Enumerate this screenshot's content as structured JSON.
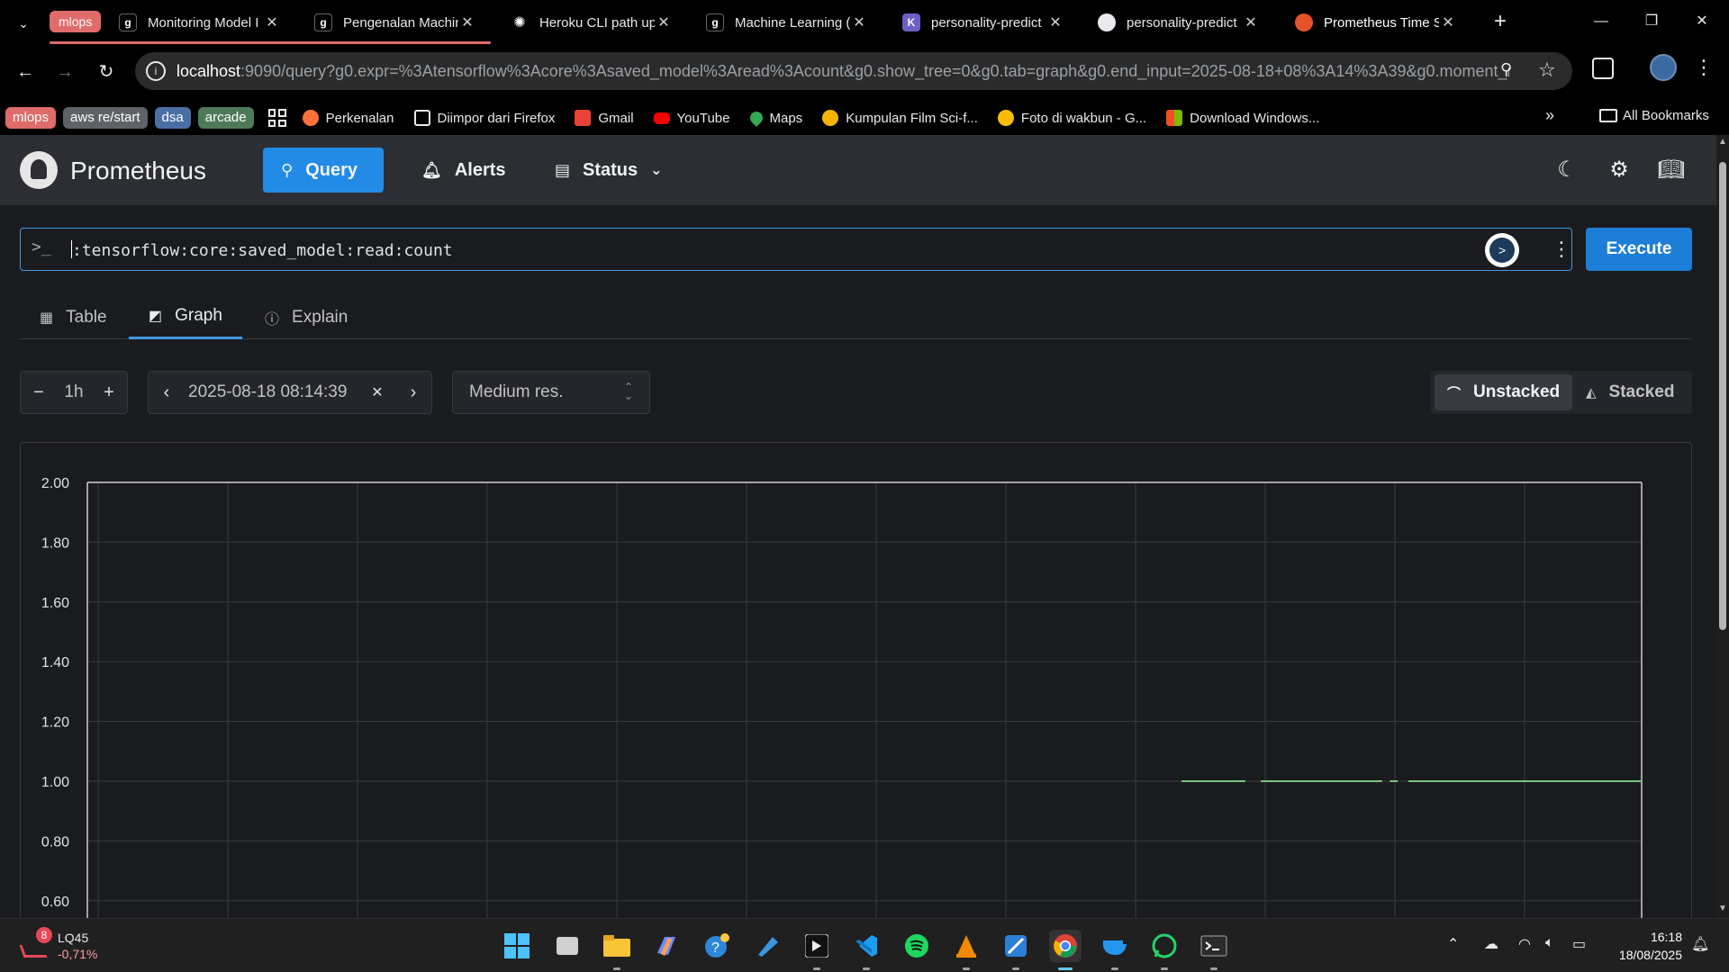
{
  "browser": {
    "tab_group_label": "mlops",
    "tabs": [
      {
        "title": "Monitoring Model I",
        "icon": "gitbook-icon",
        "active": false
      },
      {
        "title": "Pengenalan Machin",
        "icon": "gitbook-icon",
        "active": false
      },
      {
        "title": "Heroku CLI path up",
        "icon": "openai-icon",
        "active": false
      },
      {
        "title": "Machine Learning (",
        "icon": "gitbook-icon",
        "active": false
      },
      {
        "title": "personality-predict",
        "icon": "heroku-icon",
        "active": false
      },
      {
        "title": "personality-predict",
        "icon": "github-icon",
        "active": false
      },
      {
        "title": "Prometheus Time S",
        "icon": "prometheus-icon",
        "active": true
      }
    ],
    "url_host": "localhost",
    "url_rest": ":9090/query?g0.expr=%3Atensorflow%3Acore%3Asaved_model%3Aread%3Acount&g0.show_tree=0&g0.tab=graph&g0.end_input=2025-08-18+08%3A14%3A39&g0.moment_i...",
    "bookmark_chips": [
      {
        "label": "mlops",
        "color": "#e06b6b"
      },
      {
        "label": "aws re/start",
        "color": "#5f6368"
      },
      {
        "label": "dsa",
        "color": "#4a6fa5"
      },
      {
        "label": "arcade",
        "color": "#4f7a5a"
      }
    ],
    "bookmarks": [
      {
        "label": "Perkenalan",
        "icon_color": "#ff7139"
      },
      {
        "label": "Diimpor dari Firefox",
        "icon_color": "folder"
      },
      {
        "label": "Gmail",
        "icon_color": "#ea4335"
      },
      {
        "label": "YouTube",
        "icon_color": "#ff0000"
      },
      {
        "label": "Maps",
        "icon_color": "#34a853"
      },
      {
        "label": "Kumpulan Film Sci-f...",
        "icon_color": "#f4b400"
      },
      {
        "label": "Foto di wakbun - G...",
        "icon_color": "#fbbc04"
      },
      {
        "label": "Download Windows...",
        "icon_color": "#00a4ef"
      }
    ],
    "all_bookmarks_label": "All Bookmarks"
  },
  "app": {
    "brand": "Prometheus",
    "nav": {
      "query": "Query",
      "alerts": "Alerts",
      "status": "Status"
    },
    "expression": ":tensorflow:core:saved_model:read:count",
    "execute_label": "Execute",
    "tabs": {
      "table": "Table",
      "graph": "Graph",
      "explain": "Explain"
    },
    "range": "1h",
    "end_time": "2025-08-18 08:14:39",
    "resolution": "Medium res.",
    "stack": {
      "unstacked": "Unstacked",
      "stacked": "Stacked"
    }
  },
  "chart_data": {
    "type": "line",
    "title": "",
    "xlabel": "",
    "ylabel": "",
    "ylim": [
      0.6,
      2.0
    ],
    "y_ticks": [
      "2.00",
      "1.80",
      "1.60",
      "1.40",
      "1.20",
      "1.00",
      "0.80",
      "0.60"
    ],
    "x_range_fraction": [
      0,
      1
    ],
    "grid": true,
    "series": [
      {
        "color": "#7bc87b",
        "segments": [
          {
            "x": [
              0.704,
              0.745
            ],
            "y": [
              1.0,
              1.0
            ]
          },
          {
            "x": [
              0.755,
              0.833
            ],
            "y": [
              1.0,
              1.0
            ]
          },
          {
            "x": [
              0.838,
              0.843
            ],
            "y": [
              1.0,
              1.0
            ]
          },
          {
            "x": [
              0.85,
              1.0
            ],
            "y": [
              1.0,
              1.0
            ]
          }
        ]
      }
    ]
  },
  "taskbar": {
    "stock_name": "LQ45",
    "stock_change": "-0,71%",
    "stock_badge": "8",
    "time": "16:18",
    "date": "18/08/2025"
  }
}
